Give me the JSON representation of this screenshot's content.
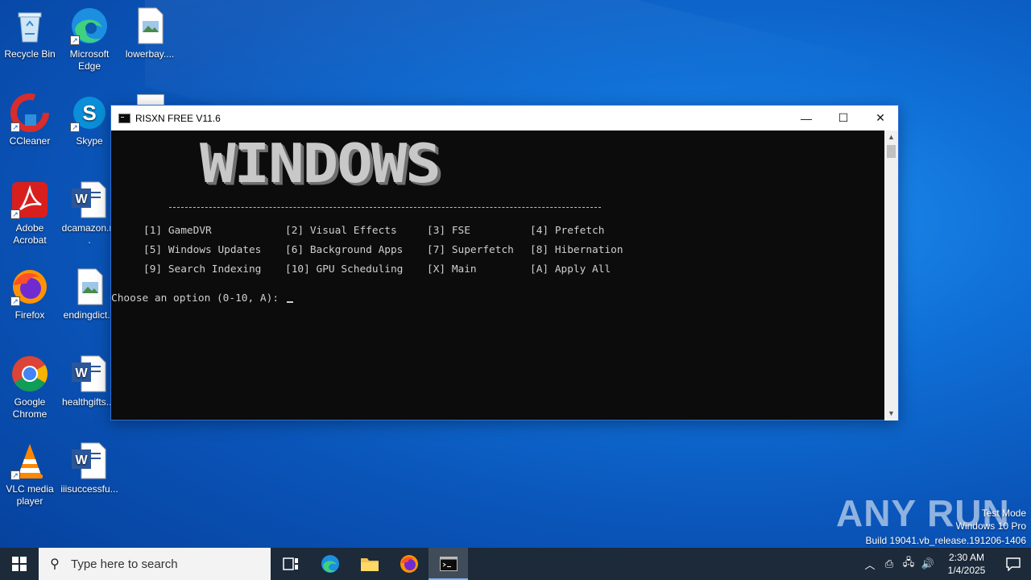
{
  "desktop": {
    "icons": [
      {
        "label": "Recycle Bin",
        "icon": "recycle-bin-icon"
      },
      {
        "label": "Microsoft Edge",
        "icon": "edge-icon"
      },
      {
        "label": "lowerbay....",
        "icon": "image-file-icon"
      },
      {
        "label": "CCleaner",
        "icon": "ccleaner-icon"
      },
      {
        "label": "Skype",
        "icon": "skype-icon"
      },
      {
        "label": "Adobe Acrobat",
        "icon": "acrobat-icon"
      },
      {
        "label": "dcamazon.r...",
        "icon": "word-doc-icon"
      },
      {
        "label": "Firefox",
        "icon": "firefox-icon"
      },
      {
        "label": "endingdict...",
        "icon": "image-file-icon"
      },
      {
        "label": "Google Chrome",
        "icon": "chrome-icon"
      },
      {
        "label": "healthgifts....",
        "icon": "word-doc-icon"
      },
      {
        "label": "VLC media player",
        "icon": "vlc-icon"
      },
      {
        "label": "iiisuccessfu...",
        "icon": "word-doc-icon"
      }
    ]
  },
  "window": {
    "title": "RISXN FREE V11.6",
    "minimize": "—",
    "maximize": "☐",
    "close": "✕"
  },
  "console": {
    "banner": "WINDOWS",
    "menu": [
      [
        "[1] GameDVR",
        "[2] Visual Effects",
        "[3] FSE",
        "[4] Prefetch"
      ],
      [
        "[5] Windows Updates",
        "[6] Background Apps",
        "[7] Superfetch",
        "[8] Hibernation"
      ],
      [
        "[9] Search Indexing",
        "[10] GPU Scheduling",
        "[X] Main",
        "[A] Apply All"
      ]
    ],
    "prompt": "Choose an option (0-10, A): "
  },
  "watermark": {
    "logo": "ANY RUN",
    "line1": "Test Mode",
    "line2": "Windows 10 Pro",
    "line3": "Build 19041.vb_release.191206-1406"
  },
  "taskbar": {
    "search_placeholder": "Type here to search",
    "time": "2:30 AM",
    "date": "1/4/2025"
  }
}
